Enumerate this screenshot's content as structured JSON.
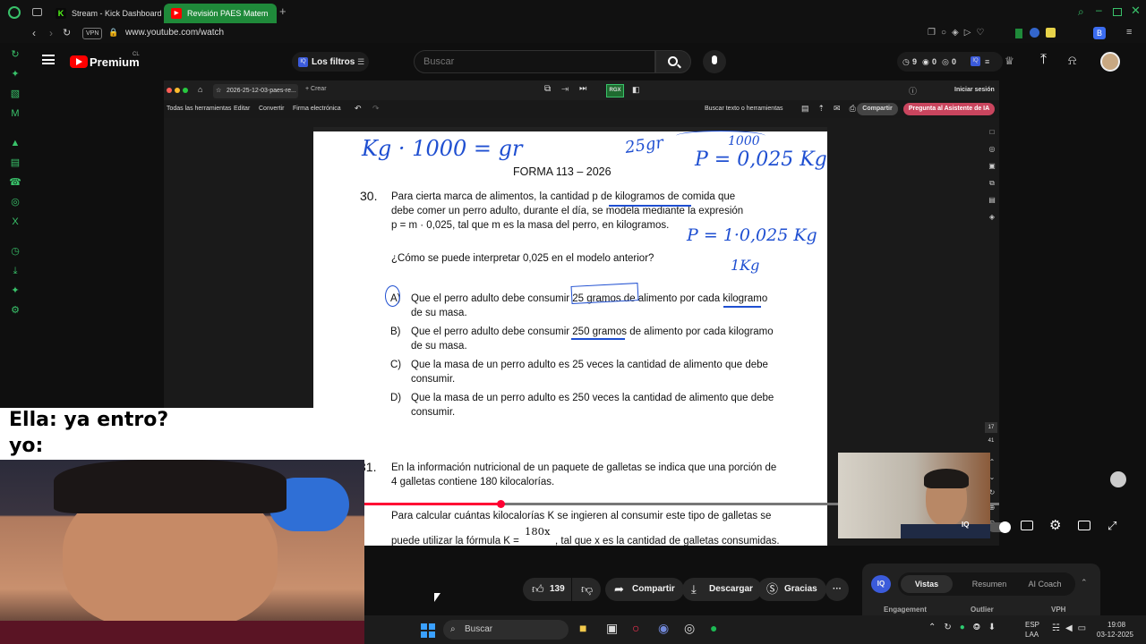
{
  "browser": {
    "tabs": [
      {
        "label": "Stream - Kick Dashboard",
        "favicon": "K"
      },
      {
        "label": "Revisión PAES Matem",
        "favicon": "▶"
      }
    ],
    "vpn_badge": "VPN",
    "url": "www.youtube.com/watch"
  },
  "youtube": {
    "logo_text": "Premium",
    "logo_region": "CL",
    "filter_chip": "Los filtros",
    "filter_badge": "IQ",
    "search_placeholder": "Buscar",
    "ext_counts": [
      "9",
      "0",
      "0"
    ],
    "ext_badge": "IQ"
  },
  "pdf": {
    "tab_title": "2026-25-12-03-paes-re...",
    "new_tab": "+ Crear",
    "rgx": "RGX",
    "login": "Iniciar sesión",
    "menu": [
      "Todas las herramientas",
      "Editar",
      "Convertir",
      "Firma electrónica"
    ],
    "search_tools": "Buscar texto o herramientas",
    "share": "Compartir",
    "ai_button": "Pregunta al Asistente de IA",
    "page_num": "17",
    "page_total": "41"
  },
  "exam": {
    "header": "FORMA 113 –  2026",
    "q30_num": "30.",
    "q30_l1": "Para cierta marca de alimentos, la cantidad p de kilogramos de comida que",
    "q30_l2": "debe comer un perro adulto, durante el día, se modela mediante la expresión",
    "q30_l3": "p = m · 0,025, tal que m es la masa del perro, en kilogramos.",
    "q30_ask": "¿Cómo se puede interpretar 0,025 en el modelo anterior?",
    "options": [
      {
        "letter": "A)",
        "l1": "Que el perro adulto debe consumir 25 gramos de alimento por cada kilogramo",
        "l2": "de su masa."
      },
      {
        "letter": "B)",
        "l1": "Que el perro adulto debe consumir 250 gramos de alimento por cada kilogramo",
        "l2": "de su masa."
      },
      {
        "letter": "C)",
        "l1": "Que la masa de un perro adulto es 25 veces la cantidad de alimento que debe",
        "l2": "consumir."
      },
      {
        "letter": "D)",
        "l1": "Que la masa de un perro adulto es 250 veces la cantidad de alimento que debe",
        "l2": "consumir."
      }
    ],
    "q31_num": "31.",
    "q31_l1": "En la información nutricional de un paquete de galletas se indica que una porción de",
    "q31_l2": "4 galletas contiene 180 kilocalorías.",
    "q31_l3": "Para calcular cuántas kilocalorías K se ingieren al consumir este tipo de galletas se",
    "q31_l4a": "puede utilizar la fórmula K =",
    "q31_frac": "180x",
    "q31_l4b": ", tal que x es la cantidad de galletas consumidas.",
    "hand_top_left": "Kg · 1000 = gr",
    "hand_25gr": "25gr",
    "hand_1000": "1000",
    "hand_p1": "P = 0,025 Kg",
    "hand_p2": "P = 1·0,025 Kg",
    "hand_1kg": "1Kg"
  },
  "meme": {
    "line1": "Ella: ya entro?",
    "line2": "yo:"
  },
  "actions": {
    "likes": "139",
    "share": "Compartir",
    "download": "Descargar",
    "thanks": "Gracias",
    "more": "···"
  },
  "panel": {
    "badge": "IQ",
    "tabs": [
      "Vistas",
      "Resumen",
      "AI Coach"
    ],
    "cols": [
      "Engagement",
      "Outlier",
      "VPH"
    ]
  },
  "taskbar": {
    "search": "Buscar",
    "lang1": "ESP",
    "lang2": "LAA",
    "time": "19:08",
    "date": "03-12-2025"
  }
}
